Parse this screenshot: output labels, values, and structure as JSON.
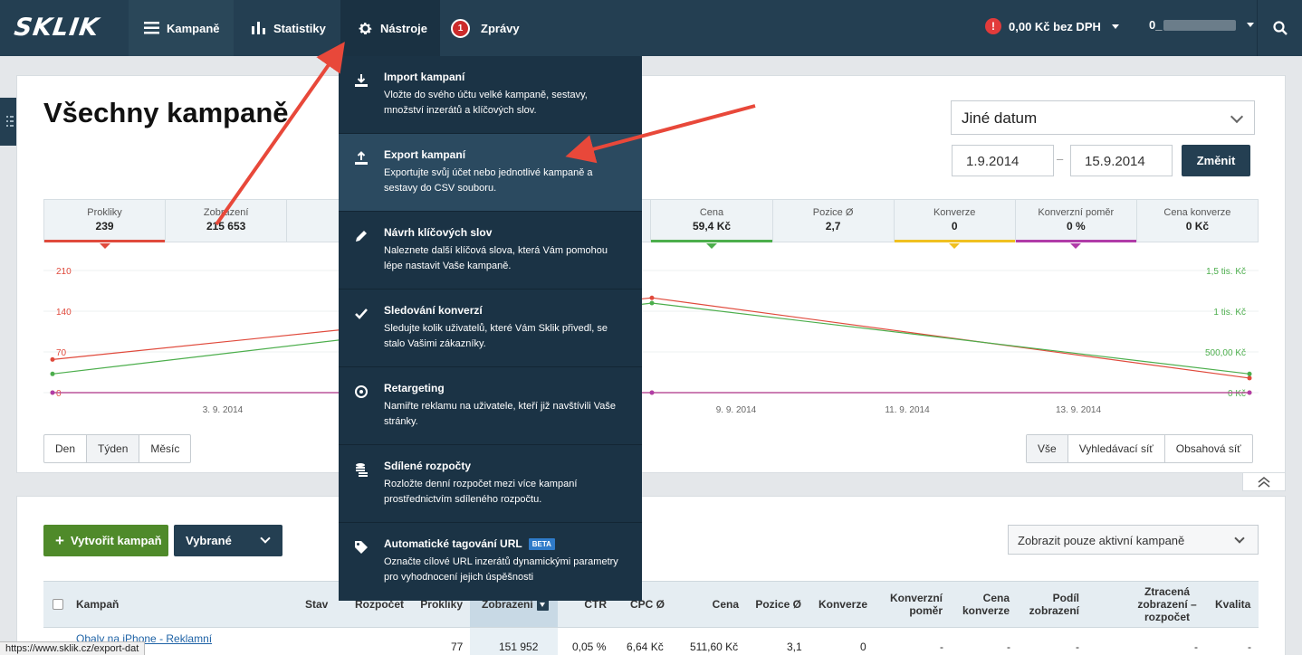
{
  "nav": {
    "logo": "SKLIK",
    "items": [
      {
        "label": "Kampaně"
      },
      {
        "label": "Statistiky"
      },
      {
        "label": "Nástroje"
      },
      {
        "label": "Zprávy",
        "badge": "1"
      }
    ],
    "credit": "0,00 Kč bez DPH",
    "user_prefix": "0_"
  },
  "page": {
    "title": "Všechny kampaně"
  },
  "date": {
    "preset": "Jiné datum",
    "from": "1.9.2014",
    "separator": "–",
    "to": "15.9.2014",
    "apply_label": "Změnit"
  },
  "metrics": [
    {
      "label": "Prokliky",
      "value": "239",
      "color": "#e04a3c"
    },
    {
      "label": "Zobrazení",
      "value": "215 653",
      "color": ""
    },
    {
      "label": "",
      "value": "",
      "color": ""
    },
    {
      "label": "",
      "value": "",
      "color": ""
    },
    {
      "label": "",
      "value": "",
      "color": ""
    },
    {
      "label": "Cena",
      "value": "59,4 Kč",
      "color": "#4cae4c"
    },
    {
      "label": "Pozice Ø",
      "value": "2,7",
      "color": ""
    },
    {
      "label": "Konverze",
      "value": "0",
      "color": "#f0c020"
    },
    {
      "label": "Konverzní poměr",
      "value": "0 %",
      "color": "#b03ca8"
    },
    {
      "label": "Cena konverze",
      "value": "0 Kč",
      "color": ""
    }
  ],
  "chart_data": {
    "type": "line",
    "x": [
      "1. 9. 2014",
      "8. 9. 2014",
      "15. 9. 2014"
    ],
    "x_ticks": [
      "3. 9. 2014",
      "9. 9. 2014",
      "11. 9. 2014",
      "13. 9. 2014"
    ],
    "y_left_ticks": [
      "210",
      "140",
      "70",
      "0"
    ],
    "y_right_ticks": [
      "1,5 tis. Kč",
      "1 tis. Kč",
      "500,00 Kč",
      "0 Kč"
    ],
    "ylim_left": [
      0,
      210
    ],
    "ylim_right": [
      0,
      1500
    ],
    "series": [
      {
        "axis": "left",
        "color": "#e04a3c",
        "values": [
          57,
          163,
          25
        ]
      },
      {
        "axis": "right",
        "color": "#4cae4c",
        "values": [
          230,
          1100,
          230
        ]
      },
      {
        "axis": "left",
        "color": "#f0c020",
        "values": [
          0,
          0,
          0
        ]
      },
      {
        "axis": "left",
        "color": "#b03ca8",
        "values": [
          0,
          0,
          0
        ]
      }
    ],
    "grid": true
  },
  "granularity": [
    "Den",
    "Týden",
    "Měsíc"
  ],
  "network": [
    "Vše",
    "Vyhledávací síť",
    "Obsahová síť"
  ],
  "campaigns": {
    "create_label": "Vytvořit kampaň",
    "selected_label": "Vybrané",
    "filter_label": "Zobrazit pouze aktivní kampaně",
    "columns": [
      "Kampaň",
      "Stav",
      "Rozpočet",
      "Prokliky",
      "Zobrazení",
      "CTR",
      "CPC Ø",
      "Cena",
      "Pozice Ø",
      "Konverze",
      "Konverzní poměr",
      "Cena konverze",
      "Podíl zobrazení",
      "Ztracená zobrazení – rozpočet",
      "Kvalita"
    ],
    "rows": [
      {
        "name": "Obaly na iPhone - Reklamní",
        "clicks": "77",
        "impressions": "151 952",
        "ctr": "0,05 %",
        "cpc": "6,64 Kč",
        "cost": "511,60 Kč",
        "position": "3,1",
        "conversions": "0",
        "conv_rate": "-",
        "conv_cost": "-",
        "share": "-",
        "lost": "-",
        "quality": "-"
      }
    ]
  },
  "status_url": "https://www.sklik.cz/export-dat",
  "menu": [
    {
      "icon": "import-icon",
      "title": "Import kampaní",
      "desc": "Vložte do svého účtu velké kampaně, sestavy, množství inzerátů a klíčových slov."
    },
    {
      "icon": "export-icon",
      "title": "Export kampaní",
      "desc": "Exportujte svůj účet nebo jednotlivé kampaně a sestavy do CSV souboru."
    },
    {
      "icon": "pencil-icon",
      "title": "Návrh klíčových slov",
      "desc": "Naleznete další klíčová slova, která Vám pomohou lépe nastavit Vaše kampaně."
    },
    {
      "icon": "check-icon",
      "title": "Sledování konverzí",
      "desc": "Sledujte kolik uživatelů, které Vám Sklik přivedl, se stalo Vašimi zákazníky."
    },
    {
      "icon": "target-icon",
      "title": "Retargeting",
      "desc": "Namiřte reklamu na uživatele, kteří již navštívili Vaše stránky."
    },
    {
      "icon": "coins-icon",
      "title": "Sdílené rozpočty",
      "desc": "Rozložte denní rozpočet mezi více kampaní prostřednictvím sdíleného rozpočtu."
    },
    {
      "icon": "tag-icon",
      "title": "Automatické tagování URL",
      "badge": "BETA",
      "desc": "Označte cílové URL inzerátů dynamickými parametry pro vyhodnocení jejich úspěšnosti"
    }
  ],
  "colors": {
    "nav": "#243f52",
    "dropdown": "#1b3345",
    "highlight": "#2b4a60",
    "annotation_arrow": "#e8483a"
  }
}
